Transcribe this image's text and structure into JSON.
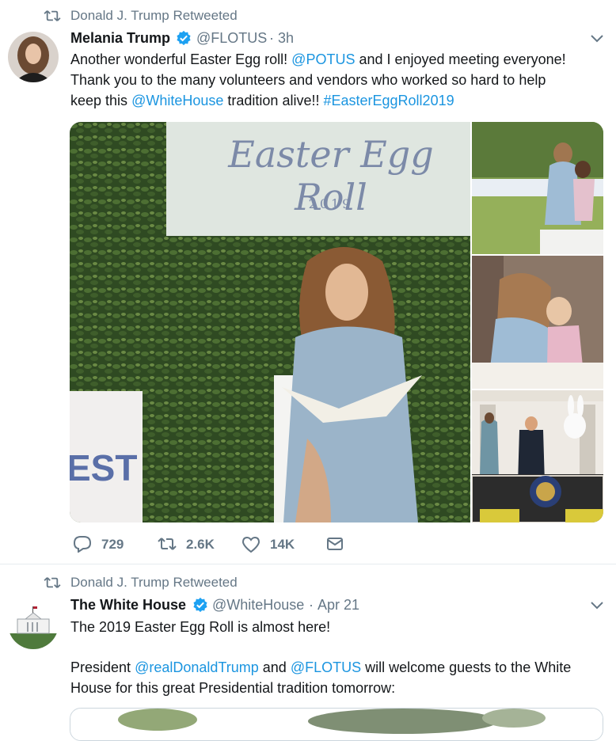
{
  "tweet1": {
    "retweet_text": "Donald J. Trump Retweeted",
    "name": "Melania Trump",
    "handle": "@FLOTUS",
    "separator": "·",
    "time": "3h",
    "line1_a": "Another wonderful Easter Egg roll!",
    "mention_potus": "@POTUS",
    "line1_b": "and I enjoyed meeting everyone!",
    "line2": "Thank you to the many volunteers and vendors who worked so hard to help",
    "line3_a": "keep this",
    "mention_whitehouse": "@WhiteHouse",
    "line3_b": "tradition alive!!",
    "hashtag": "#EasterEggRoll2019",
    "photo_sign_title": "Easter Egg Roll",
    "photo_sign_year": "2019",
    "photo_side_sign": "EST",
    "replies": "729",
    "retweets": "2.6K",
    "likes": "14K"
  },
  "tweet2": {
    "retweet_text": "Donald J. Trump Retweeted",
    "name": "The White House",
    "handle": "@WhiteHouse",
    "separator": "·",
    "time": "Apr 21",
    "line1": "The 2019 Easter Egg Roll is almost here!",
    "line2_a": "President",
    "mention_trump": "@realDonaldTrump",
    "line2_b": "and",
    "mention_flotus": "@FLOTUS",
    "line2_c": "will welcome guests to the White",
    "line3": "House for this great Presidential tradition tomorrow:"
  },
  "colors": {
    "link": "#1b95e0",
    "secondary_text": "#657786",
    "verified": "#1da1f2",
    "divider": "#e6ecf0"
  },
  "icons": [
    "retweet-icon",
    "verified-badge-icon",
    "chevron-down-icon",
    "reply-icon",
    "like-icon",
    "direct-message-icon"
  ]
}
